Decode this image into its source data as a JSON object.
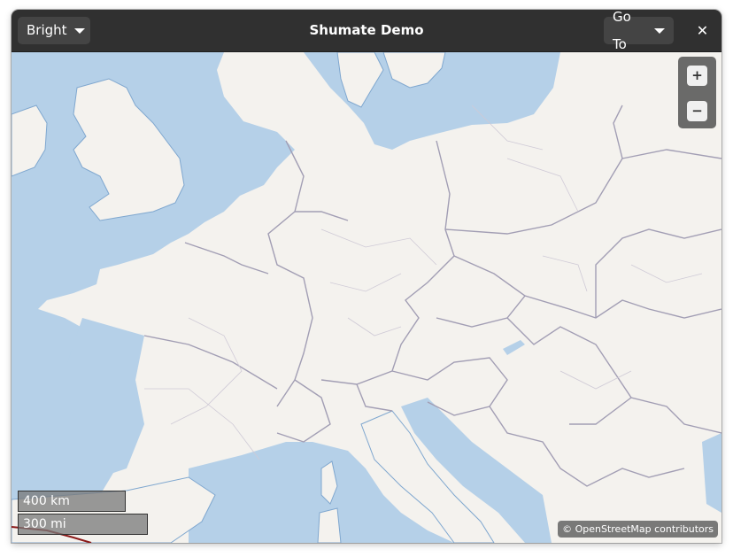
{
  "header": {
    "style_selector": "Bright",
    "title": "Shumate Demo",
    "goto_label": "Go To",
    "close_glyph": "✕"
  },
  "map": {
    "zoom_in_glyph": "+",
    "zoom_out_glyph": "−",
    "scale_metric": "400 km",
    "scale_imperial": "300 mi",
    "attribution": "© OpenStreetMap contributors",
    "colors": {
      "water": "#b5d0e8",
      "land": "#f4f2ee",
      "border": "#a29eb4",
      "coast": "#7fa7cf",
      "header": "#303030"
    }
  }
}
